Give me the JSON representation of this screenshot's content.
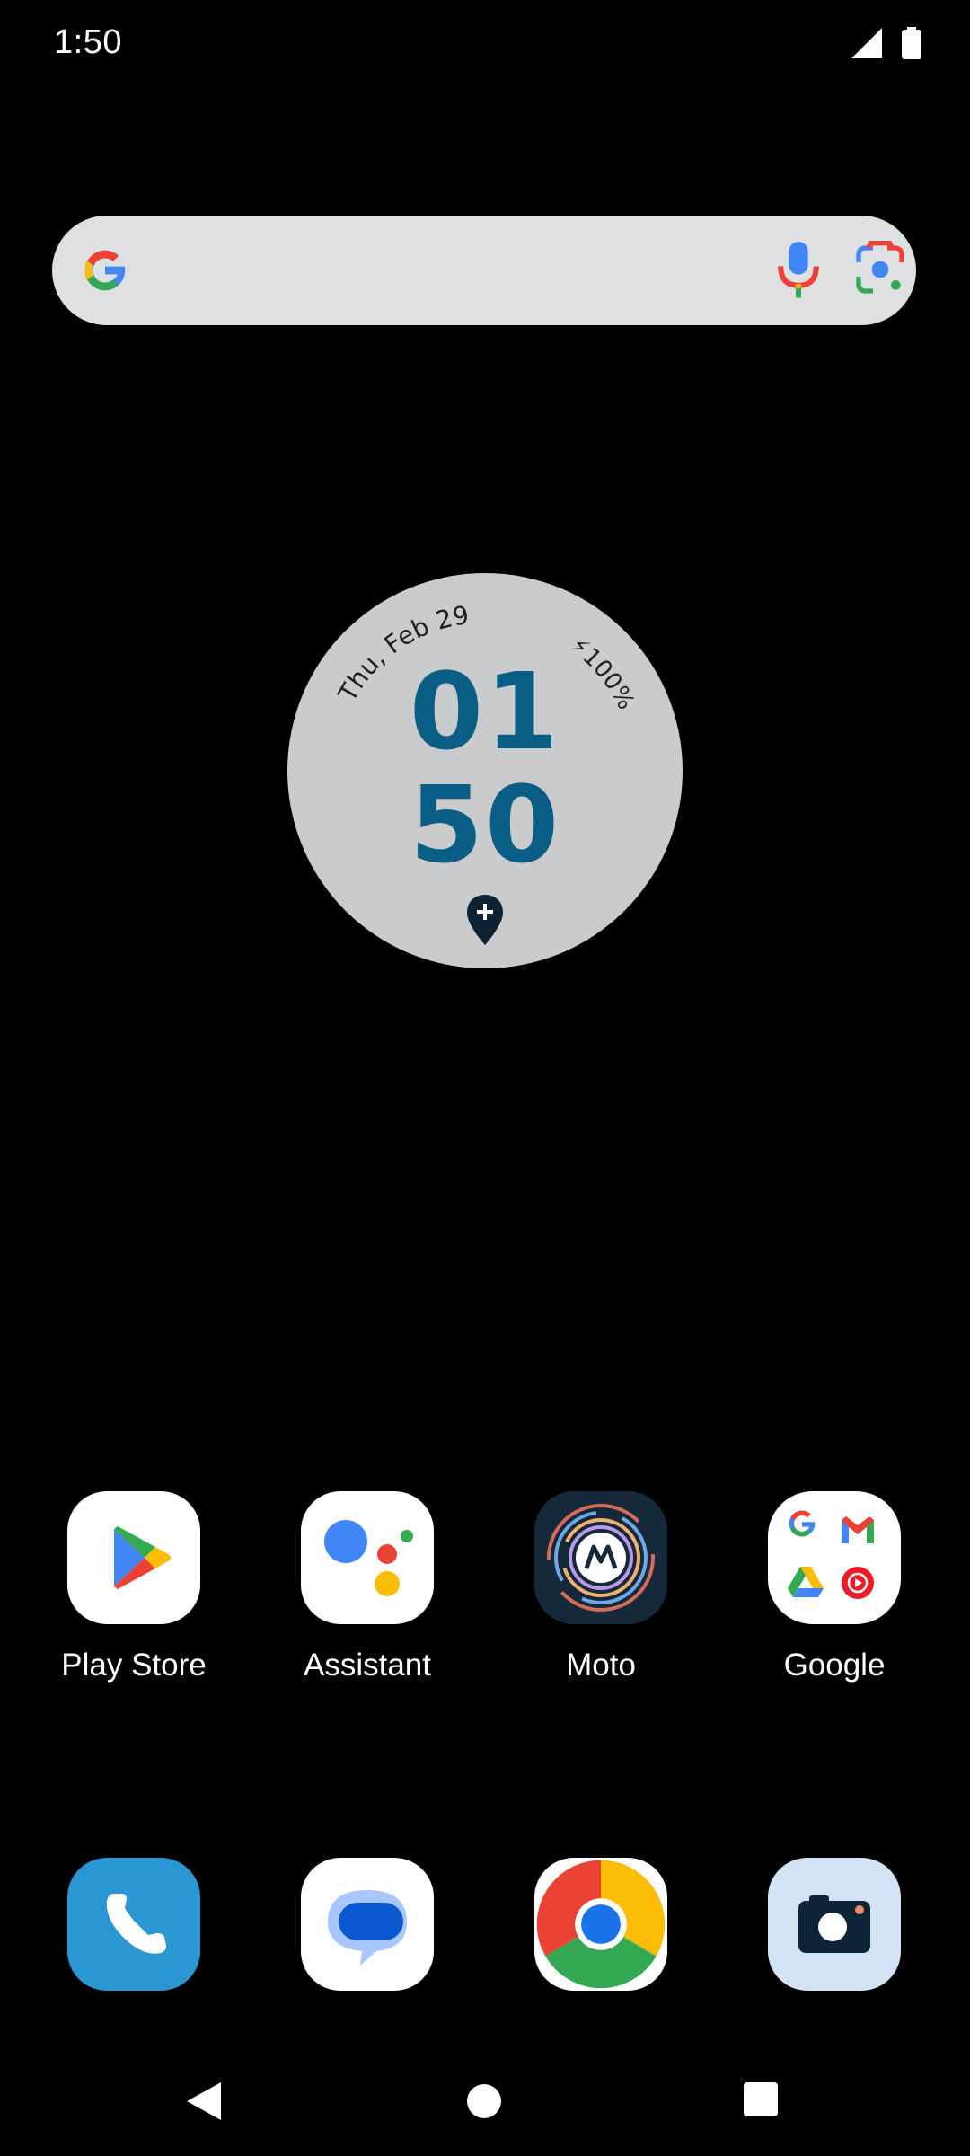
{
  "status_bar": {
    "time": "1:50",
    "icons": [
      "signal-icon",
      "battery-icon"
    ]
  },
  "search_bar": {
    "icons": [
      "google-g-icon",
      "mic-icon",
      "lens-icon"
    ]
  },
  "clock_widget": {
    "date": "Thu, Feb 29",
    "battery": "100%",
    "hour": "01",
    "minute": "50",
    "icons": [
      "charging-bolt-icon",
      "location-pin-icon"
    ]
  },
  "home_apps": [
    {
      "label": "Play Store",
      "icon": "play-store-icon"
    },
    {
      "label": "Assistant",
      "icon": "assistant-icon"
    },
    {
      "label": "Moto",
      "icon": "moto-icon"
    },
    {
      "label": "Google",
      "icon": "google-folder-icon"
    }
  ],
  "dock_apps": [
    {
      "icon": "phone-icon"
    },
    {
      "icon": "messages-icon"
    },
    {
      "icon": "chrome-icon"
    },
    {
      "icon": "camera-icon"
    }
  ],
  "nav_bar": {
    "icons": [
      "back-icon",
      "home-icon",
      "recents-icon"
    ]
  },
  "colors": {
    "clock_digits": "#0a5e86",
    "widget_bg": "#cacbcd",
    "search_bg": "#dfe0e2"
  }
}
